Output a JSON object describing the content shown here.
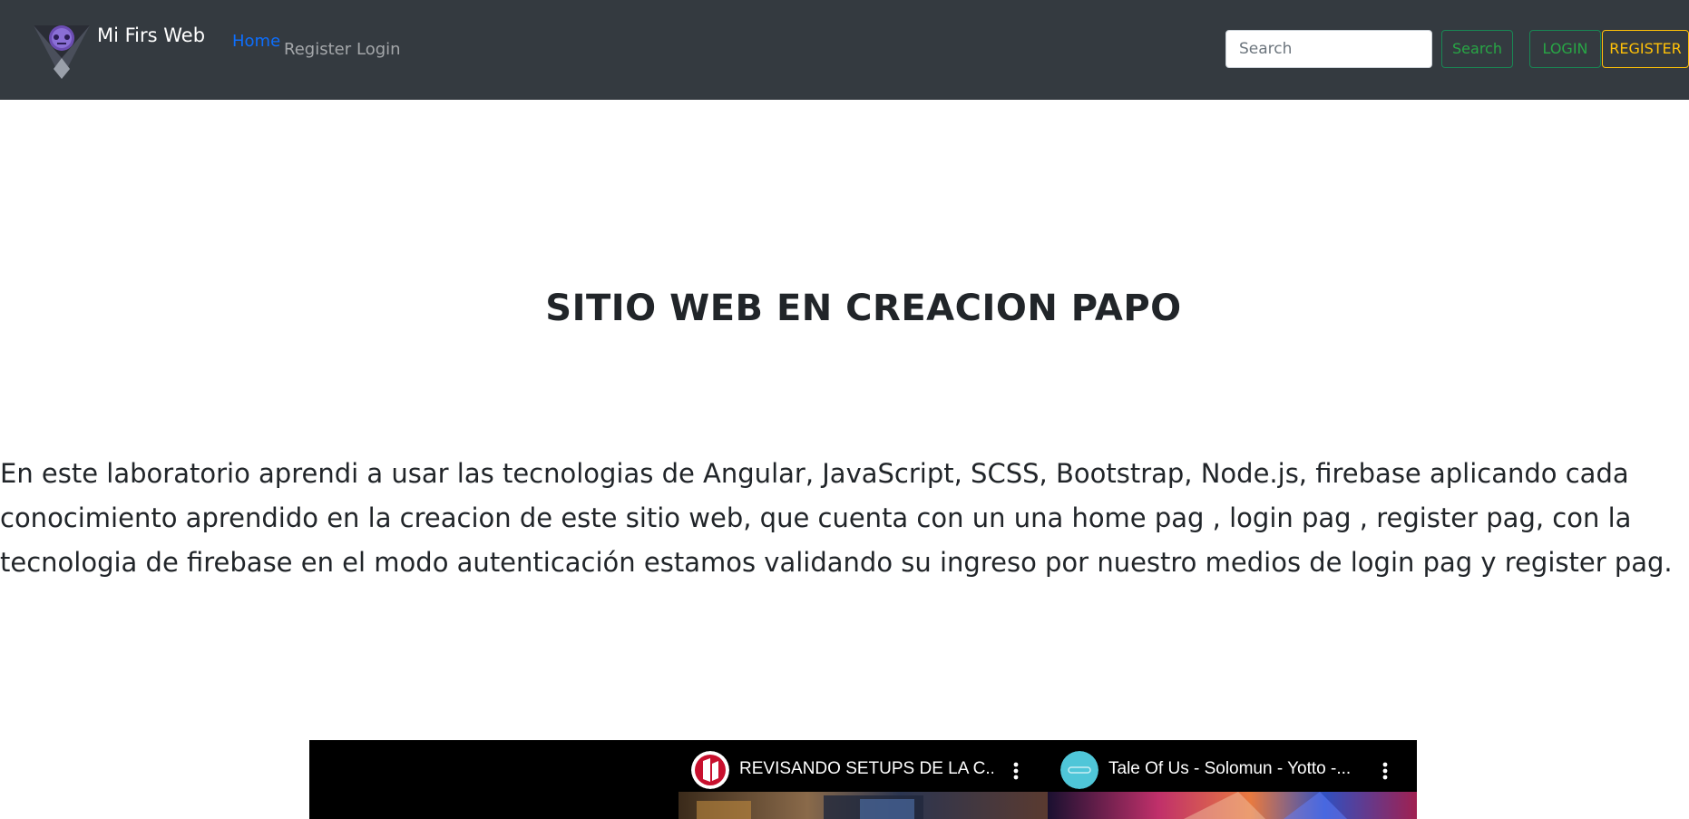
{
  "navbar": {
    "brand_name": "Mi Firs Web",
    "links": [
      {
        "label": "Home",
        "active": true
      },
      {
        "label": "Register",
        "active": false
      },
      {
        "label": "Login",
        "active": false
      }
    ],
    "search": {
      "placeholder": "Search",
      "value": "",
      "button_label": "Search"
    },
    "login_label": "LOGIN",
    "register_label": "REGISTER",
    "colors": {
      "background": "#343a40",
      "active_link": "#0d6efd",
      "green": "#28a745",
      "yellow": "#ffc107"
    }
  },
  "hero": {
    "title": "SITIO WEB EN CREACION PAPO",
    "description_lines": [
      "En este laboratorio aprendi a usar las tecnologias de Angular, JavaScript, SCSS, Bootstrap, Node.js, firebase aplicando cada",
      "conocimiento aprendido en la creacion de este sitio web, que cuenta con un una home pag , login pag , register pag, con la",
      "tecnologia de firebase en el modo autenticación estamos validando su ingreso por nuestro medios de login pag y register pag."
    ]
  },
  "video_embed": {
    "videos": [
      {
        "title": "REVISANDO SETUPS DE LA C...",
        "avatar_icon": "channel-logo-red",
        "more_icon": "more-vertical-icon"
      },
      {
        "title": "Tale Of Us - Solomun - Yotto -...",
        "avatar_icon": "channel-logo-cyan",
        "more_icon": "more-vertical-icon"
      }
    ]
  }
}
